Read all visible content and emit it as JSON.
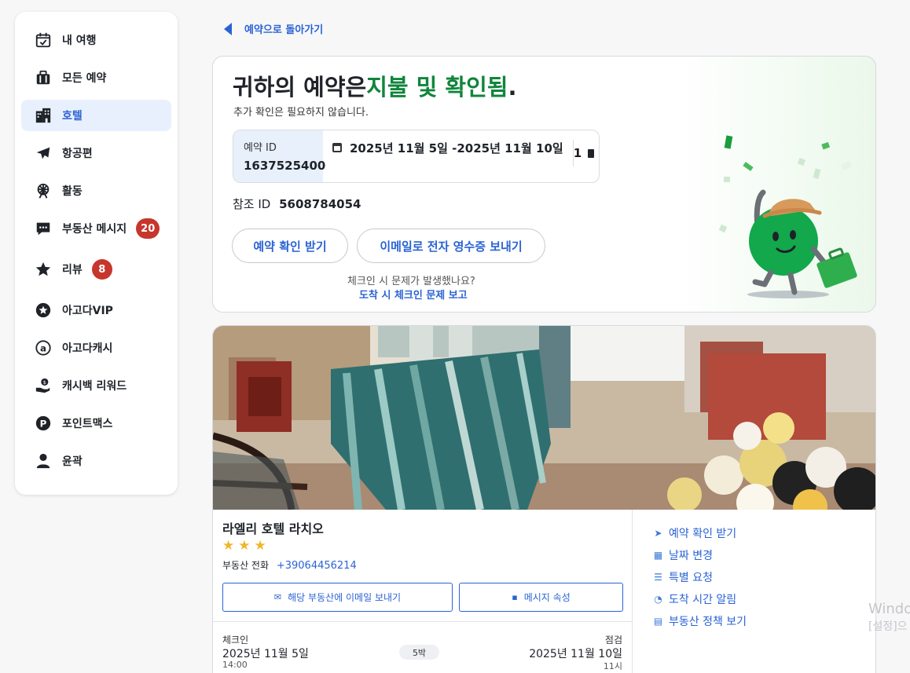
{
  "sidebar": {
    "items": [
      {
        "label": "내 여행",
        "icon": "calendar-check-icon"
      },
      {
        "label": "모든 예약",
        "icon": "briefcase-icon"
      },
      {
        "label": "호텔",
        "icon": "buildings-icon",
        "active": true
      },
      {
        "label": "항공편",
        "icon": "airplane-icon"
      },
      {
        "label": "활동",
        "icon": "ferris-wheel-icon"
      },
      {
        "label": "부동산 메시지",
        "icon": "chat-bubble-icon",
        "badge": "20"
      },
      {
        "label": "리뷰",
        "icon": "star-icon",
        "badge": "8"
      },
      {
        "label": "아고다VIP",
        "icon": "vip-star-icon"
      },
      {
        "label": "아고다캐시",
        "icon": "agoda-cash-icon"
      },
      {
        "label": "캐시백 리워드",
        "icon": "cashback-icon"
      },
      {
        "label": "포인트맥스",
        "icon": "pointsmax-icon"
      },
      {
        "label": "윤곽",
        "icon": "person-icon"
      }
    ]
  },
  "back_link": "예약으로 돌아가기",
  "confirmation": {
    "title_prefix": "귀하의 예약은",
    "title_status": "지불 및 확인됨",
    "title_suffix": ".",
    "subtitle": "추가 확인은 필요하지 않습니다.",
    "booking_id_label": "예약 ID",
    "booking_id": "1637525400",
    "dates": "2025년 11월 5일 -2025년 11월 10일",
    "room_count": "1",
    "reference_label": "참조 ID",
    "reference_id": "5608784054",
    "btn_get_confirmation": "예약 확인 받기",
    "btn_email_receipt": "이메일로 전자 영수증 보내기",
    "checkin_problem_question": "체크인 시 문제가 발생했나요?",
    "checkin_problem_link": "도착 시 체크인 문제 보고"
  },
  "hotel": {
    "name": "라엘리 호텔 라치오",
    "stars": 3,
    "phone_label": "부동산 전화",
    "phone": "+39064456214",
    "btn_email_property": "해당 부동산에 이메일 보내기",
    "btn_message": "메시지 속성",
    "checkin_label": "체크인",
    "checkin_date": "2025년 11월 5일",
    "checkin_time": "14:00",
    "nights": "5박",
    "checkout_label": "점검",
    "checkout_date": "2025년 11월 10일",
    "checkout_time": "11시",
    "actions": [
      {
        "label": "예약 확인 받기",
        "icon": "send-icon"
      },
      {
        "label": "날짜 변경",
        "icon": "calendar-icon"
      },
      {
        "label": "특별 요청",
        "icon": "checklist-icon"
      },
      {
        "label": "도착 시간 알림",
        "icon": "clock-icon"
      },
      {
        "label": "부동산 정책 보기",
        "icon": "policy-icon"
      }
    ]
  },
  "watermark": {
    "line1": "Windo",
    "line2": "[설정]으"
  }
}
